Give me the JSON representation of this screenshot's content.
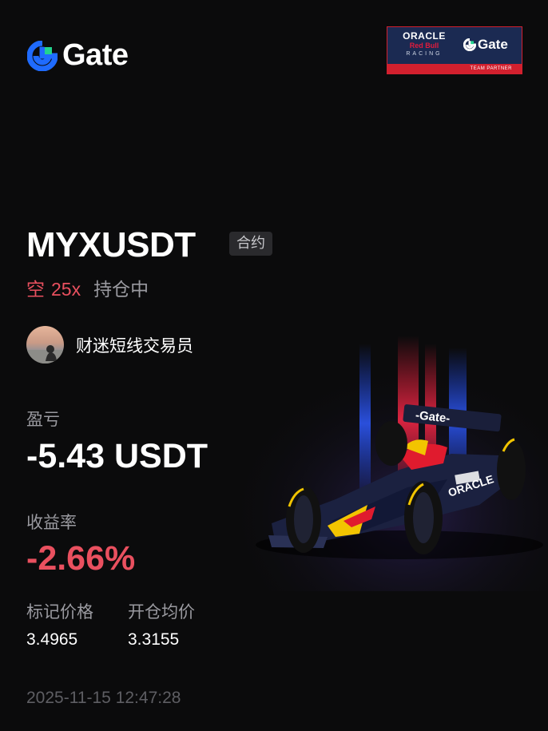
{
  "brand": {
    "name": "Gate",
    "logo_icon": "gate-logo-icon",
    "accent_blue": "#1f6bff",
    "accent_green": "#22d48f"
  },
  "partner_badge": {
    "oracle": "ORACLE",
    "red_bull": "Red Bull",
    "racing": "RACING",
    "gate": "Gate",
    "strip": "TEAM PARTNER"
  },
  "position": {
    "pair": "MYXUSDT",
    "tag": "合约",
    "side": "空",
    "leverage": "25x",
    "status": "持仓中"
  },
  "user": {
    "name": "财迷短线交易员"
  },
  "pnl": {
    "label": "盈亏",
    "value": "-5.43 USDT"
  },
  "roi": {
    "label": "收益率",
    "value": "-2.66%"
  },
  "prices": {
    "mark_label": "标记价格",
    "mark_value": "3.4965",
    "entry_label": "开仓均价",
    "entry_value": "3.3155"
  },
  "timestamp": "2025-11-15 12:47:28",
  "colors": {
    "negative": "#e9505f",
    "muted": "#9a9aa0",
    "background": "#0b0b0c"
  }
}
